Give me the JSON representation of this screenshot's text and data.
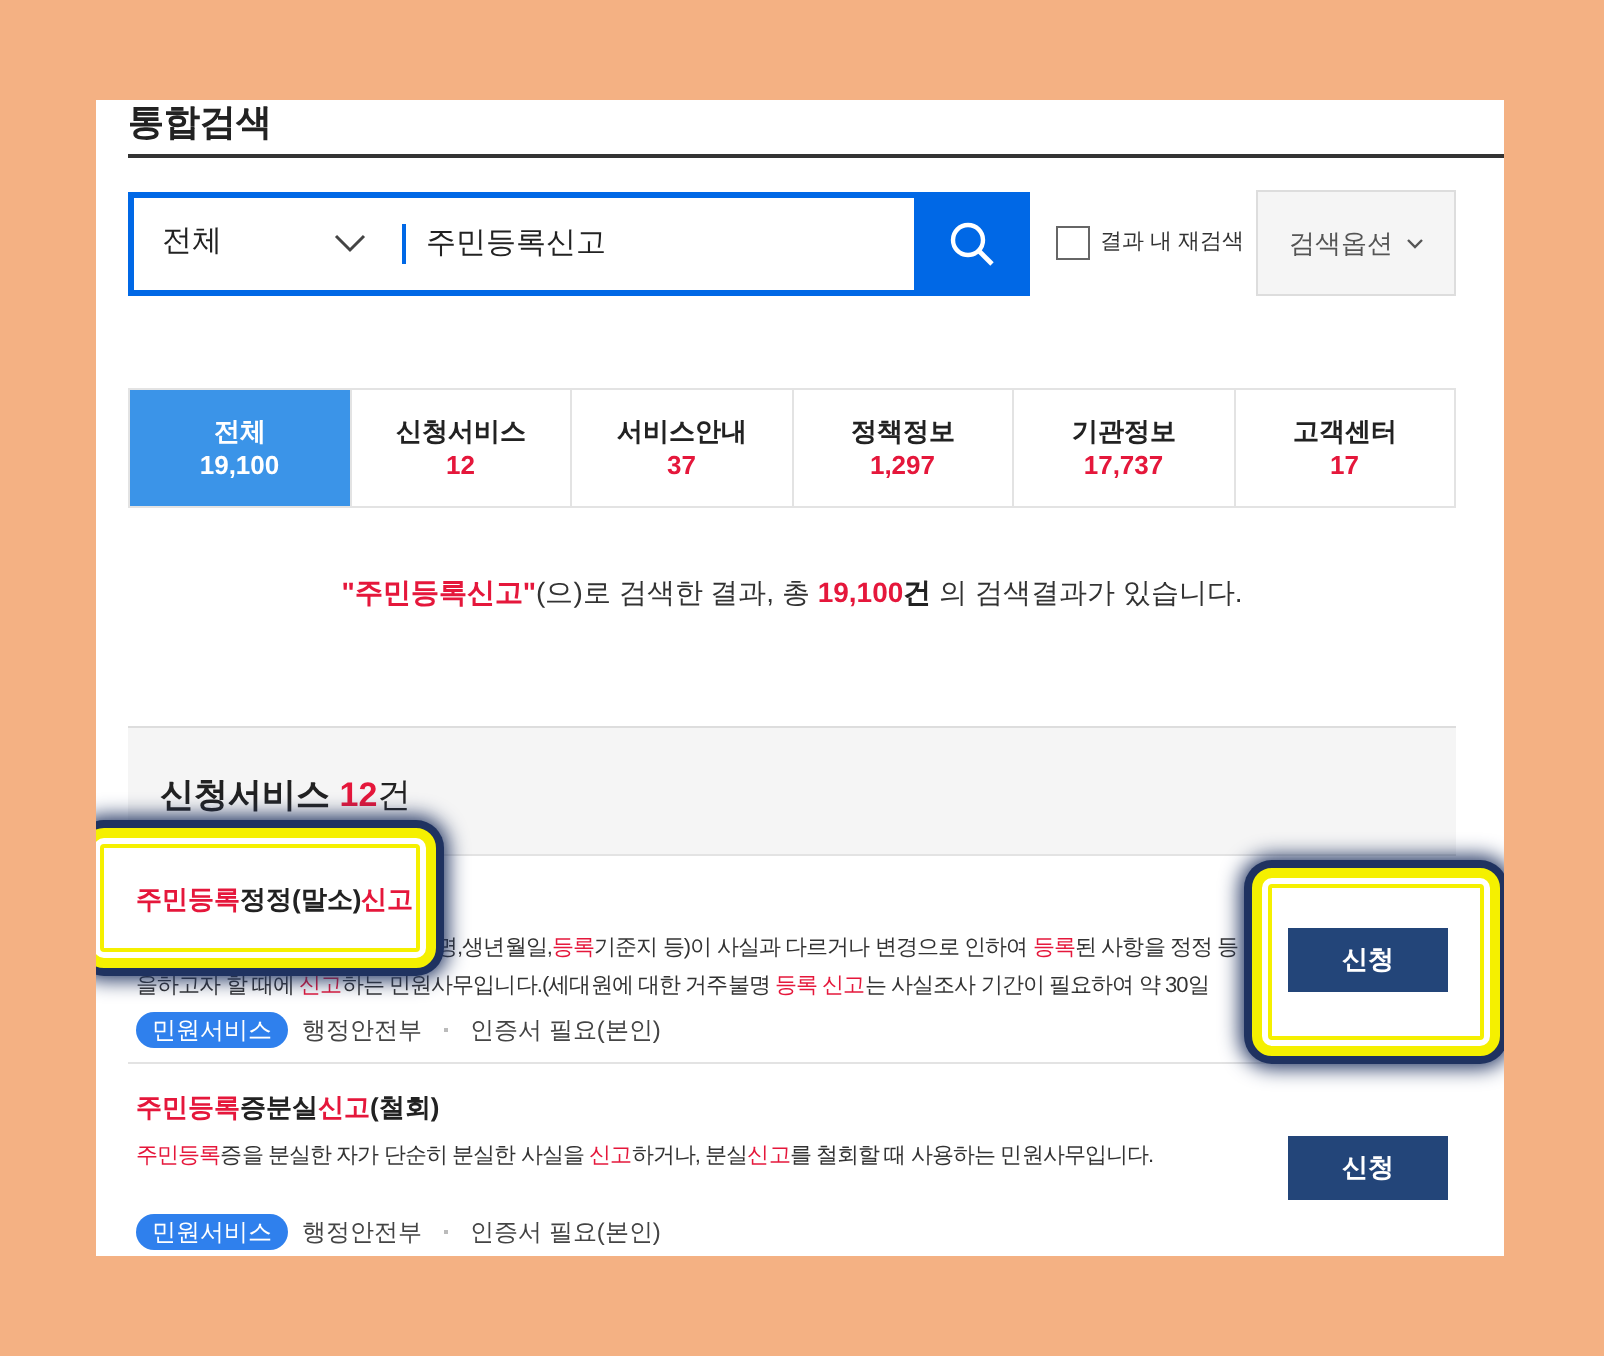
{
  "page_title": "통합검색",
  "search": {
    "scope": "전체",
    "query": "주민등록신고",
    "refine": {
      "label": "결과 내 재검색",
      "checked": false
    },
    "options_button": "검색옵션"
  },
  "tabs": [
    {
      "label": "전체",
      "count": "19,100",
      "selected": true
    },
    {
      "label": "신청서비스",
      "count": "12",
      "selected": false
    },
    {
      "label": "서비스안내",
      "count": "37",
      "selected": false
    },
    {
      "label": "정책정보",
      "count": "1,297",
      "selected": false
    },
    {
      "label": "기관정보",
      "count": "17,737",
      "selected": false
    },
    {
      "label": "고객센터",
      "count": "17",
      "selected": false
    }
  ],
  "summary": [
    {
      "text": "\"주민등록신고\"",
      "kind": "keyword"
    },
    {
      "text": "(으)로 검색한 결과, 총 ",
      "kind": "plain"
    },
    {
      "text": "19,100",
      "kind": "keyword"
    },
    {
      "text": "건",
      "kind": "strong"
    },
    {
      "text": " 의 검색결과가 있습니다.",
      "kind": "plain"
    }
  ],
  "section": {
    "title": "신청서비스",
    "count": "12",
    "unit": "건"
  },
  "items": [
    {
      "title": [
        {
          "text": "주민등록",
          "red": true
        },
        {
          "text": "정정(말소)",
          "red": false
        },
        {
          "text": "신고",
          "red": true
        }
      ],
      "title_highlighted": true,
      "description": [
        [
          {
            "text": "명,생년월일,",
            "red": false
          },
          {
            "text": "등록",
            "red": true
          },
          {
            "text": "기준지 등)이 사실과 다르거나 변경으로 인하여 ",
            "red": false
          },
          {
            "text": "등록",
            "red": true
          },
          {
            "text": "된 사항을 정정 등",
            "red": false
          }
        ],
        [
          {
            "text": "을하고자 할 때에 ",
            "red": false
          },
          {
            "text": "신고",
            "red": true
          },
          {
            "text": "하는 민원사무입니다.(세대원에 대한 거주불명 ",
            "red": false
          },
          {
            "text": "등록 신고",
            "red": true
          },
          {
            "text": "는 사실조사 기간이 필요하여 약 30일",
            "red": false
          }
        ]
      ],
      "tag": "민원서비스",
      "agency": "행정안전부",
      "requirement": "인증서 필요(본인)",
      "button": "신청",
      "button_highlighted": true
    },
    {
      "title": [
        {
          "text": "주민등록",
          "red": true
        },
        {
          "text": "증분실",
          "red": false
        },
        {
          "text": "신고",
          "red": true
        },
        {
          "text": "(철회)",
          "red": false
        }
      ],
      "title_highlighted": false,
      "description": [
        [
          {
            "text": "주민등록",
            "red": true
          },
          {
            "text": "증을 분실한 자가 단순히 분실한 사실을 ",
            "red": false
          },
          {
            "text": "신고",
            "red": true
          },
          {
            "text": "하거나, 분실",
            "red": false
          },
          {
            "text": "신고",
            "red": true
          },
          {
            "text": "를 철회할 때 사용하는 민원사무입니다.",
            "red": false
          }
        ]
      ],
      "tag": "민원서비스",
      "agency": "행정안전부",
      "requirement": "인증서 필요(본인)",
      "button": "신청",
      "button_highlighted": false
    }
  ]
}
